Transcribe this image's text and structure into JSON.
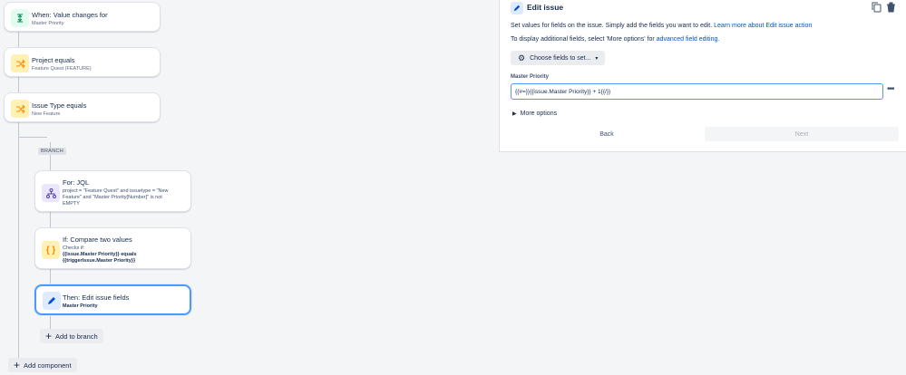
{
  "flow": {
    "trigger": {
      "title": "When: Value changes for",
      "sub": "Master Priority",
      "icon": "trigger-icon"
    },
    "condition1": {
      "title": "Project equals",
      "sub": "Feature Quest (FEATURE)",
      "icon": "shuffle-icon"
    },
    "condition2": {
      "title": "Issue Type equals",
      "sub": "New Feature",
      "icon": "shuffle-icon"
    },
    "branch_tag": "BRANCH",
    "branch_for": {
      "title": "For: JQL",
      "desc": "project = \"Feature Quest\" and issuetype = \"New Feature\" and \"Master Priority[Number]\" is not EMPTY",
      "icon": "branch-icon"
    },
    "branch_if": {
      "title": "If: Compare two values",
      "checks": "Checks if:",
      "line1": "{{issue.Master Priority}} equals",
      "line2": "{{triggerIssue.Master Priority}}",
      "icon": "braces-icon"
    },
    "branch_then": {
      "title": "Then: Edit issue fields",
      "sub": "Master Priority",
      "icon": "pencil-icon"
    },
    "add_to_branch": "Add to branch",
    "add_component": "Add component"
  },
  "panel": {
    "title": "Edit issue",
    "intro": "Set values for fields on the issue. Simply add the fields you want to edit.",
    "intro_link": "Learn more about Edit issue action",
    "additional": "To display additional fields, select 'More options' for",
    "additional_link": "advanced field editing.",
    "choose_fields": "Choose fields to set...",
    "field_label": "Master Priority",
    "field_value": "{{#=}}{{issue.Master Priority}} + 1{{/}}",
    "more_options": "More options",
    "back": "Back",
    "next": "Next"
  },
  "colors": {
    "accent": "#0052cc",
    "selected_border": "#4c9aff",
    "canvas": "#f4f5f7"
  }
}
